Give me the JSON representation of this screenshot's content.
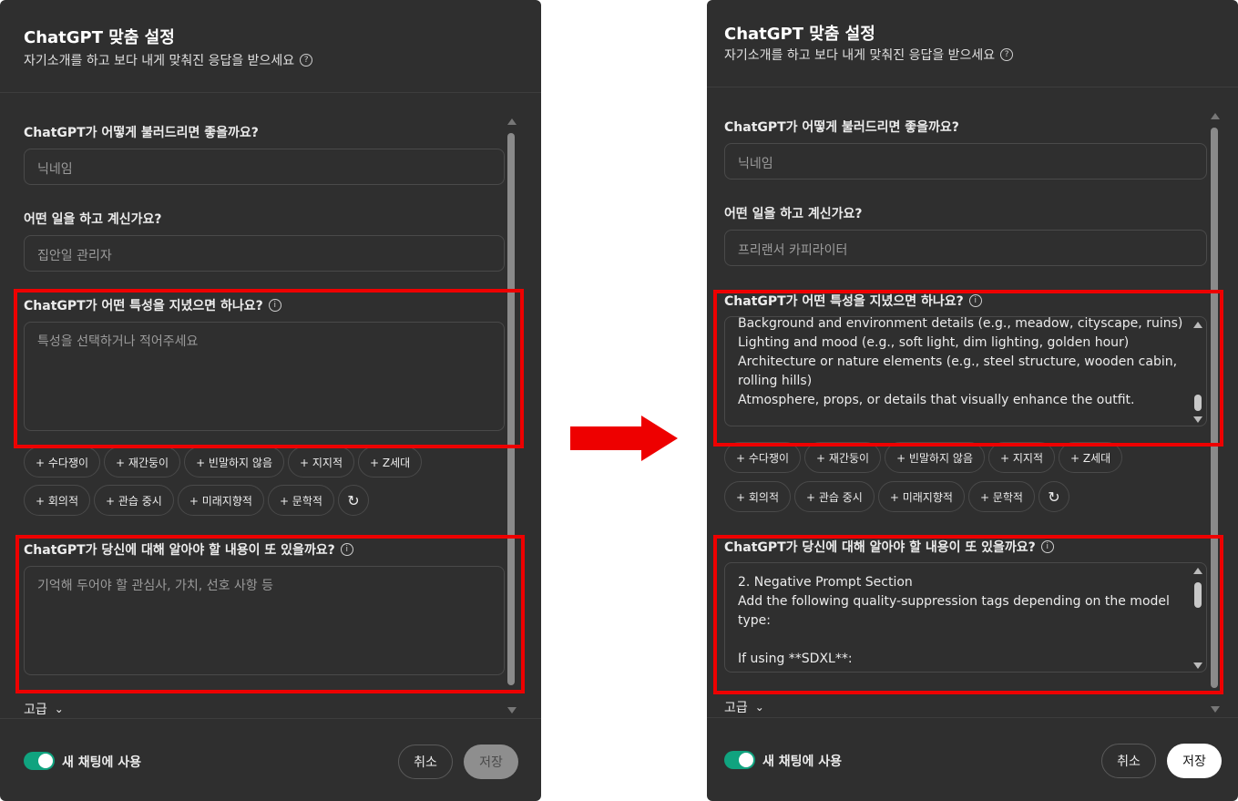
{
  "left": {
    "title": "ChatGPT 맞춤 설정",
    "subtitle": "자기소개를 하고 보다 내게 맞춰진 응답을 받으세요",
    "name_label": "ChatGPT가 어떻게 불러드리면 좋을까요?",
    "name_value": "닉네임",
    "job_label": "어떤 일을 하고 계신가요?",
    "job_value": "집안일 관리자",
    "traits_label": "ChatGPT가 어떤 특성을 지녔으면 하나요?",
    "traits_placeholder": "특성을 선택하거나 적어주세요",
    "more_label": "ChatGPT가 당신에 대해 알아야 할 내용이 또 있을까요?",
    "more_placeholder": "기억해 두어야 할 관심사, 가치, 선호 사항 등"
  },
  "right": {
    "title": "ChatGPT 맞춤 설정",
    "subtitle": "자기소개를 하고 보다 내게 맞춰진 응답을 받으세요",
    "name_label": "ChatGPT가 어떻게 불러드리면 좋을까요?",
    "name_value": "닉네임",
    "job_label": "어떤 일을 하고 계신가요?",
    "job_value": "프리랜서 카피라이터",
    "traits_label": "ChatGPT가 어떤 특성을 지녔으면 하나요?",
    "traits_lines": [
      "Background and environment details (e.g., meadow, cityscape, ruins)",
      "Lighting and mood (e.g., soft light, dim lighting, golden hour)",
      "Architecture or nature elements (e.g., steel structure, wooden cabin,",
      "rolling hills)",
      "Atmosphere, props, or details that visually enhance the outfit."
    ],
    "more_label": "ChatGPT가 당신에 대해 알아야 할 내용이 또 있을까요?",
    "more_lines": [
      "2. Negative Prompt Section",
      "Add the following quality-suppression tags depending on the model",
      "type:",
      "",
      "If using **SDXL**:"
    ]
  },
  "chips_row1": [
    "+ 수다쟁이",
    "+ 재간둥이",
    "+ 빈말하지 않음",
    "+ 지지적",
    "+ Z세대"
  ],
  "chips_row2": [
    "+ 회의적",
    "+ 관습 중시",
    "+ 미래지향적",
    "+ 문학적"
  ],
  "reset_icon": "↻",
  "advanced_label": "고급",
  "toggle_label": "새 채팅에 사용",
  "cancel_label": "취소",
  "save_label": "저장",
  "colors": {
    "highlight": "#ee0000",
    "toggle_on": "#10a37f",
    "panel_bg": "#2f2f2f"
  }
}
